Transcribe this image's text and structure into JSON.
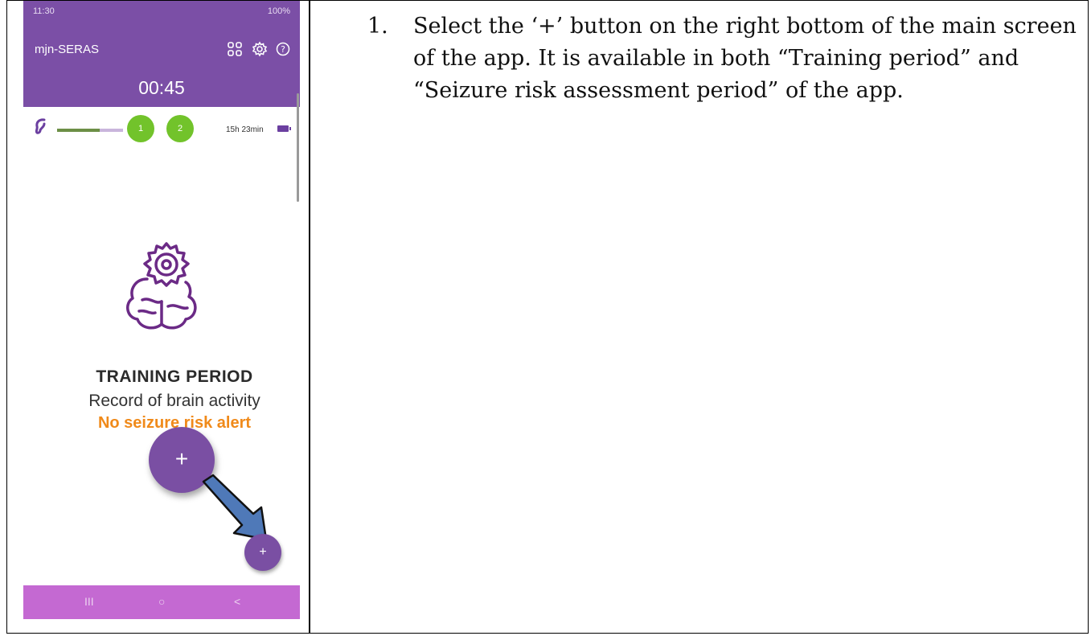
{
  "instruction": {
    "number": "1.",
    "text": "Select the ‘+’ button on the right bottom of the main screen of the app. It is available in both “Training period” and “Seizure risk assessment period” of the app."
  },
  "phone": {
    "status_bar": {
      "time": "11:30",
      "battery": "100%"
    },
    "app_title": "mjn-SERAS",
    "header_icons": [
      "grid-icon",
      "gear-icon",
      "help-icon"
    ],
    "timer": "00:45",
    "device": {
      "channels": [
        "1",
        "2"
      ],
      "battery_time": "15h 23min",
      "signal_level": 0.65
    },
    "training": {
      "title": "TRAINING PERIOD",
      "subtitle": "Record of brain activity",
      "alert": "No seizure risk alert"
    },
    "fab_label": "+",
    "nav": {
      "recent": "III",
      "home": "○",
      "back": "<"
    },
    "colors": {
      "primary": "#7b4fa6",
      "channel": "#72c32b",
      "alert": "#f08a1a",
      "nav": "#c469d2",
      "arrow": "#4f79b8"
    }
  }
}
